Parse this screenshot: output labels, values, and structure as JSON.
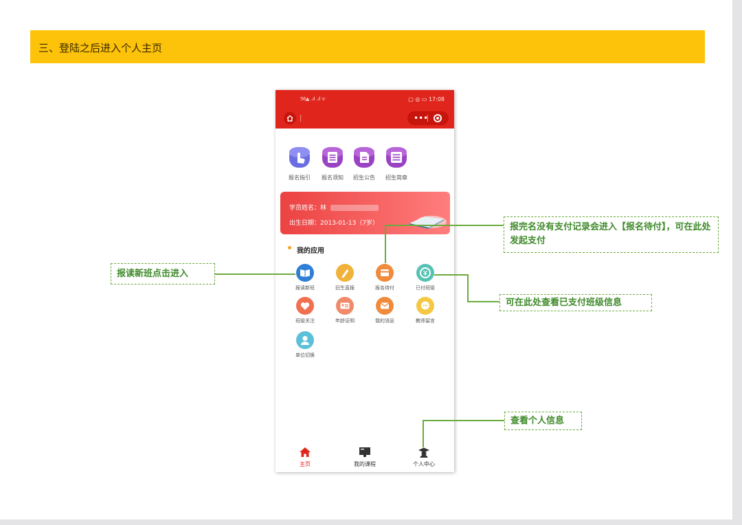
{
  "header": {
    "title": "三、登陆之后进入个人主页"
  },
  "phone": {
    "status_left": "56▲ ..ıl ..ıl ᯤ",
    "status_right": "▢ ◎ ▭ 17:08",
    "quick_items": [
      {
        "label": "报名指引",
        "color": "#6b6ee0"
      },
      {
        "label": "报名须知",
        "color": "#9a42c4"
      },
      {
        "label": "招生公告",
        "color": "#9a42c4"
      },
      {
        "label": "招生简章",
        "color": "#9a42c4"
      }
    ],
    "student_card": {
      "name_label": "学员姓名：",
      "name_value": "林",
      "birth_label": "出生日期：",
      "birth_value": "2013-01-13（7岁）"
    },
    "section_title": "我的应用",
    "apps": [
      {
        "label": "报读新班",
        "color": "#2f7fd6"
      },
      {
        "label": "旧生直报",
        "color": "#f0b23a"
      },
      {
        "label": "报名待付",
        "color": "#f08a3c"
      },
      {
        "label": "已付班级",
        "color": "#55c2b4"
      },
      {
        "label": "班级关注",
        "color": "#f07050"
      },
      {
        "label": "年龄证明",
        "color": "#f08a6a"
      },
      {
        "label": "我的消息",
        "color": "#f08a3c"
      },
      {
        "label": "教师留言",
        "color": "#f5c842"
      },
      {
        "label": "单位切换",
        "color": "#5cc0d8"
      }
    ],
    "tabs": [
      {
        "label": "主页"
      },
      {
        "label": "我的课程"
      },
      {
        "label": "个人中心"
      }
    ]
  },
  "callouts": {
    "new_class": "报读新班点击进入",
    "pending_payment": "报完名没有支付记录会进入【报名待付】，可在此处发起支付",
    "paid_class": "可在此处查看已支付班级信息",
    "personal_info": "查看个人信息"
  }
}
